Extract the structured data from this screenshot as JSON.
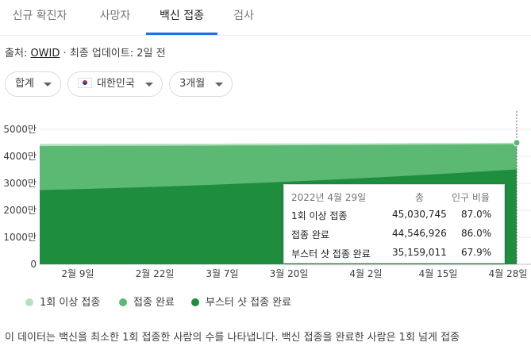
{
  "tabs": [
    {
      "label": "신규 확진자",
      "active": false
    },
    {
      "label": "사망자",
      "active": false
    },
    {
      "label": "백신 접종",
      "active": true
    },
    {
      "label": "검사",
      "active": false
    }
  ],
  "source": {
    "prefix": "출처:",
    "link": "OWID",
    "separator": "·",
    "updated": "최종 업데이트: 2일 전"
  },
  "filters": {
    "scope": "합계",
    "country": "대한민국",
    "range": "3개월"
  },
  "colors": {
    "accent": "#1a73e8",
    "one_dose": "#b7e0bf",
    "fully": "#5bb974",
    "booster": "#1e8e3e"
  },
  "chart_data": {
    "type": "area",
    "x_labels": [
      "2월 9일",
      "2월 22일",
      "3월 7일",
      "3월 20일",
      "4월 2일",
      "4월 15일",
      "4월 28일"
    ],
    "y_ticks": [
      "0",
      "1000만",
      "2000만",
      "3000만",
      "4000만",
      "5000만"
    ],
    "ylim": [
      0,
      50000000
    ],
    "series": [
      {
        "name": "1회 이상 접종",
        "start": 44600000,
        "end": 45030745
      },
      {
        "name": "접종 완료",
        "start": 43800000,
        "end": 44546926
      },
      {
        "name": "부스터 샷 접종 완료",
        "start": 27500000,
        "end": 35159011
      }
    ],
    "grid": true,
    "legend_position": "bottom"
  },
  "tooltip": {
    "date": "2022년 4월 29일",
    "col_total": "총",
    "col_pct": "인구 비율",
    "rows": [
      {
        "label": "1회 이상 접종",
        "total": "45,030,745",
        "pct": "87.0%"
      },
      {
        "label": "접종 완료",
        "total": "44,546,926",
        "pct": "86.0%"
      },
      {
        "label": "부스터 샷 접종 완료",
        "total": "35,159,011",
        "pct": "67.9%"
      }
    ]
  },
  "description": "이 데이터는 백신을 최소한 1회 접종한 사람의 수를 나타냅니다. 백신 접종을 완료한 사람은 1회 넘게 접종"
}
